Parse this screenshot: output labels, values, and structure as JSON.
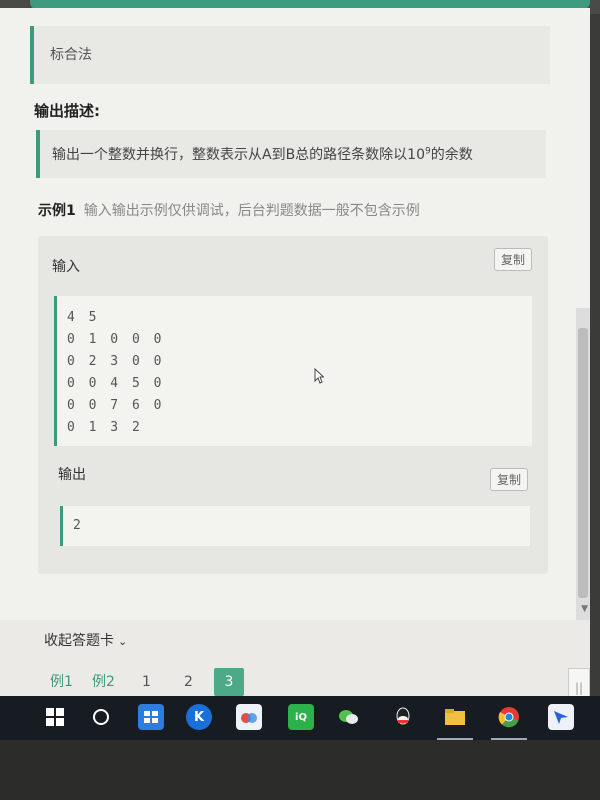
{
  "intro": {
    "text": "标合法"
  },
  "output_desc": {
    "title": "输出描述:",
    "text_before": "输出一个整数并换行，整数表示从A到B总的路径条数除以10",
    "superscript": "9",
    "text_after": "的余数"
  },
  "example": {
    "title": "示例1",
    "note": "输入输出示例仅供调试，后台判题数据一般不包含示例",
    "input_label": "输入",
    "input_lines": [
      "4 5",
      "0 1 0 0 0",
      "0 2 3 0 0",
      "0 0 4 5 0",
      "0 0 7 6 0",
      "0 1 3 2"
    ],
    "output_label": "输出",
    "output_value": "2",
    "copy_label": "复制"
  },
  "answer_card": {
    "collapse_label": "收起答题卡",
    "tabs": [
      "例1",
      "例2",
      "1",
      "2",
      "3"
    ],
    "active_tab": "3"
  },
  "taskbar": {
    "icons": [
      "windows-start-icon",
      "cortana-icon",
      "task-view-icon",
      "kugou-icon",
      "baidu-netdisk-icon",
      "iqiyi-icon",
      "wechat-icon",
      "qq-icon",
      "file-explorer-icon",
      "chrome-icon",
      "feishu-icon"
    ]
  },
  "colors": {
    "accent": "#3e9a7e",
    "active_tab": "#4caa88",
    "taskbar": "#171b22"
  }
}
